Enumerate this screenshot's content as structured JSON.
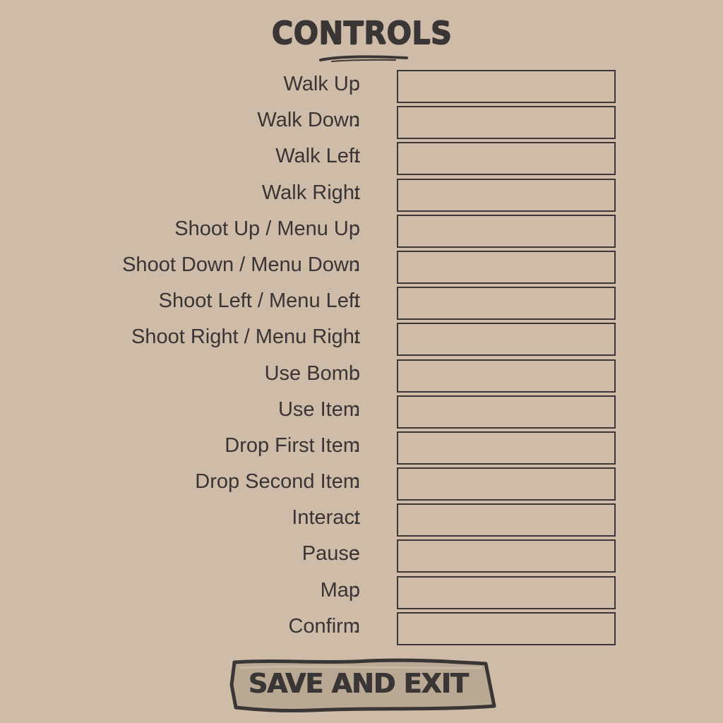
{
  "title": "CONTROLS",
  "controls": [
    {
      "label": "Walk Up",
      "key": ""
    },
    {
      "label": "Walk Down",
      "key": ""
    },
    {
      "label": "Walk Left",
      "key": ""
    },
    {
      "label": "Walk Right",
      "key": ""
    },
    {
      "label": "Shoot Up / Menu Up",
      "key": ""
    },
    {
      "label": "Shoot Down / Menu Down",
      "key": ""
    },
    {
      "label": "Shoot Left / Menu Left",
      "key": ""
    },
    {
      "label": "Shoot Right / Menu Right",
      "key": ""
    },
    {
      "label": "Use Bomb",
      "key": ""
    },
    {
      "label": "Use Item",
      "key": ""
    },
    {
      "label": "Drop First Item",
      "key": ""
    },
    {
      "label": "Drop Second Item",
      "key": ""
    },
    {
      "label": "Interact",
      "key": ""
    },
    {
      "label": "Pause",
      "key": ""
    },
    {
      "label": "Map",
      "key": ""
    },
    {
      "label": "Confirm",
      "key": ""
    }
  ],
  "separator": ":",
  "save_button": {
    "label": "SAVE AND EXIT"
  },
  "colors": {
    "background": "#cebca8",
    "ink": "#3a3434"
  }
}
